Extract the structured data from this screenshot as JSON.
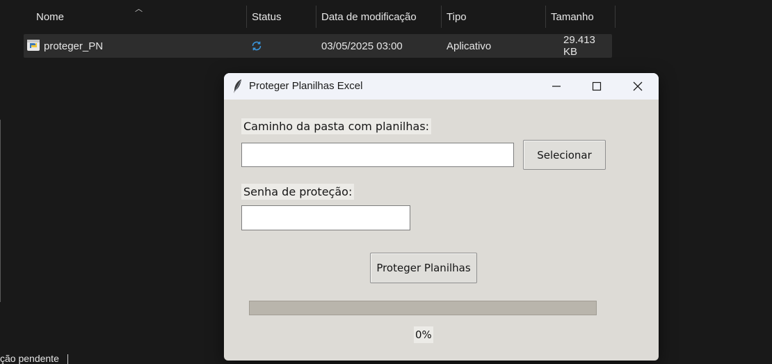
{
  "explorer": {
    "columns": {
      "name": "Nome",
      "status": "Status",
      "modified": "Data de modificação",
      "type": "Tipo",
      "size": "Tamanho"
    },
    "file": {
      "name": "proteger_PN",
      "status_icon": "sync-icon",
      "modified": "03/05/2025 03:00",
      "type": "Aplicativo",
      "size": "29.413 KB"
    },
    "footer_text": "ção pendente"
  },
  "dialog": {
    "title": "Proteger Planilhas Excel",
    "folder_label": "Caminho da pasta com planilhas:",
    "folder_value": "",
    "select_button": "Selecionar",
    "password_label": "Senha de proteção:",
    "password_value": "",
    "protect_button": "Proteger Planilhas",
    "progress": 0,
    "progress_text": "0%"
  },
  "colors": {
    "explorer_bg": "#191919",
    "dialog_bg": "#dddbd6",
    "titlebar_bg": "#f1f3f9",
    "progress_track": "#b9b5ac",
    "status_icon": "#3a96dd"
  }
}
